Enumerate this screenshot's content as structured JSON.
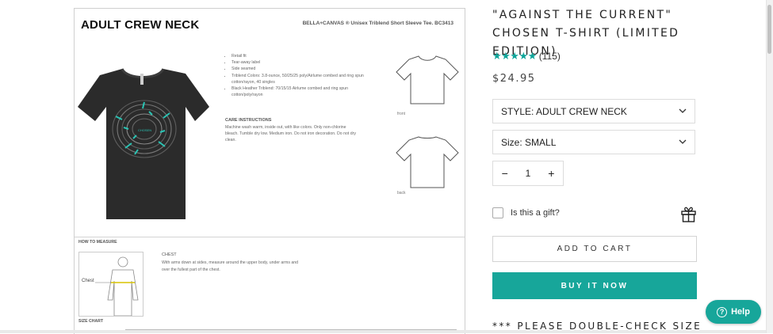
{
  "spec_sheet": {
    "title": "ADULT CREW NECK",
    "subtitle": "BELLA+CANVAS ® Unisex Triblend Short Sleeve Tee. BC3413",
    "bullets": [
      "Retail fit",
      "Tear-away label",
      "Side seamed",
      "Triblend Colors: 3.8-ounce, 50/25/25 poly/Airlume combed and ring spun cotton/rayon, 40 singles",
      "Black Heather Triblend: 70/15/15 Airlume combed and ring spun cotton/poly/rayon"
    ],
    "care_title": "CARE INSTRUCTIONS",
    "care_text": "Machine wash warm, inside out, with like colors. Only non-chlorine bleach. Tumble dry low. Medium iron. Do not iron decoration. Do not dry clean.",
    "front_label": "front",
    "back_label": "back",
    "measure_title": "HOW TO MEASURE",
    "chest_label": "CHEST",
    "chest_text": "With arms down at sides, measure around the upper body, under arms and over the fullest part of the chest.",
    "chest_marker": "Chest",
    "size_chart_title": "SIZE CHART"
  },
  "product": {
    "title": "\"AGAINST THE CURRENT\" CHOSEN T-SHIRT (LIMITED EDITION)",
    "stars": "★★★★★",
    "reviews": "(115)",
    "price": "$24.95",
    "style_select": "STYLE: ADULT CREW NECK",
    "size_select": "Size: SMALL",
    "quantity": "1",
    "minus": "−",
    "plus": "+",
    "gift_label": "Is this a gift?",
    "add_to_cart": "ADD TO CART",
    "buy_now": "BUY IT NOW",
    "note": "*** PLEASE DOUBLE-CHECK SIZE"
  },
  "help_widget": {
    "q": "?",
    "label": "Help"
  },
  "colors": {
    "accent": "#17a69a",
    "stars": "#0fa59a"
  }
}
